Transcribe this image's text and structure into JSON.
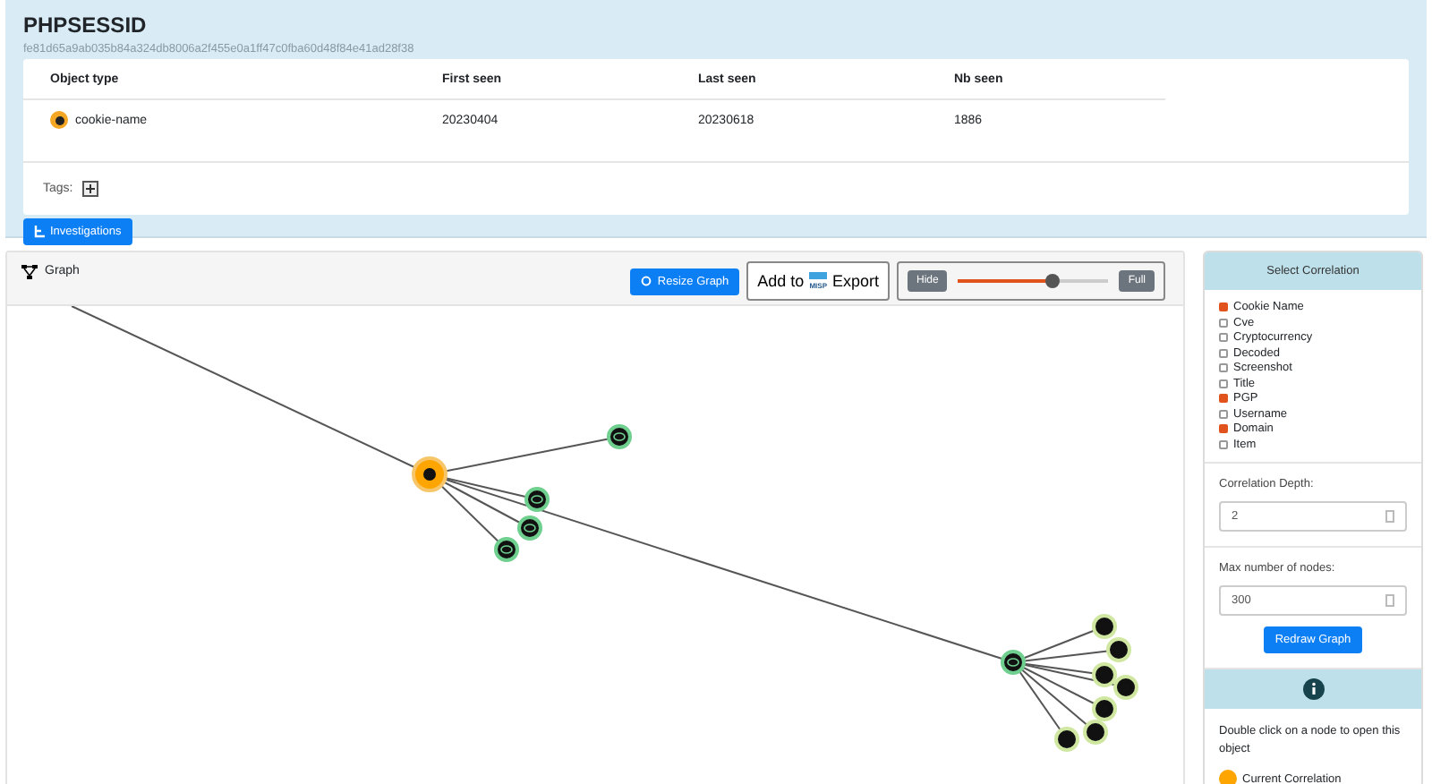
{
  "object": {
    "title": "PHPSESSID",
    "hash": "fe81d65a9ab035b84a324db8006a2f455e0a1ff47c0fba60d48f84e41ad28f38"
  },
  "table": {
    "columns": [
      "Object type",
      "First seen",
      "Last seen",
      "Nb seen"
    ],
    "rows": [
      {
        "type": "cookie-name",
        "first_seen": "20230404",
        "last_seen": "20230618",
        "nb_seen": "1886"
      }
    ]
  },
  "tags": {
    "label": "Tags:"
  },
  "investigations_button": "Investigations",
  "graph": {
    "title": "Graph",
    "resize_button": "Resize Graph",
    "misp_button": {
      "before": "Add to",
      "logo": "MISP",
      "after": "Export"
    },
    "hide_button": "Hide",
    "full_button": "Full",
    "slider": {
      "level": 0.63
    }
  },
  "correlation": {
    "title": "Select Correlation",
    "options": [
      {
        "label": "Cookie Name",
        "checked": true
      },
      {
        "label": "Cve",
        "checked": false
      },
      {
        "label": "Cryptocurrency",
        "checked": false
      },
      {
        "label": "Decoded",
        "checked": false
      },
      {
        "label": "Screenshot",
        "checked": false
      },
      {
        "label": "Title",
        "checked": false
      },
      {
        "label": "PGP",
        "checked": true
      },
      {
        "label": "Username",
        "checked": false
      },
      {
        "label": "Domain",
        "checked": true
      },
      {
        "label": "Item",
        "checked": false
      }
    ],
    "depth_label": "Correlation Depth:",
    "depth_value": "2",
    "max_label": "Max number of nodes:",
    "max_value": "300",
    "redraw_button": "Redraw Graph"
  },
  "info": {
    "text": "Double click on a node to open this object",
    "legend": [
      {
        "label": "Current Correlation",
        "color": "#ffa500"
      }
    ]
  }
}
